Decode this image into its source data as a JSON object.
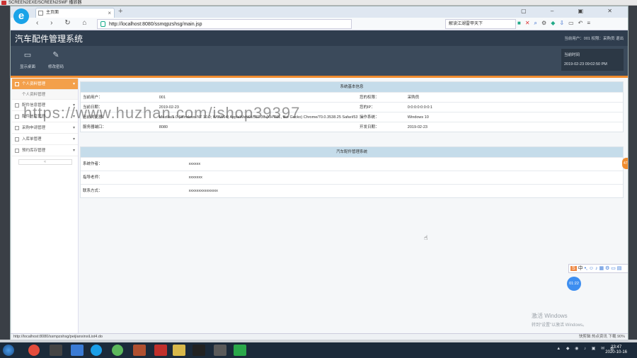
{
  "player": {
    "title": "SCREEN2EXE/SCREEN2SWF 播放器"
  },
  "browser": {
    "tab_title": "主页面",
    "url": "http://localhost:8080/ssmqpzshsg/main.jsp",
    "search_text": "解读江湖雷甲天下",
    "status_url": "http://localhost:8080/ssmpzshsg/peijianxinxiList4.do",
    "status_right": "快剪辑   热点资讯   下载   90%"
  },
  "app": {
    "title": "汽车配件管理系统",
    "userinfo": "当前用户：001  权限：采购员  退出",
    "toolbar": [
      {
        "label": "显示桌面",
        "icon": "monitor-icon"
      },
      {
        "label": "修改密码",
        "icon": "pencil-icon"
      }
    ],
    "time_label": "当前时间",
    "time_value": "2019-02-23 09:02:50 PM"
  },
  "sidebar": {
    "items": [
      {
        "label": "个人资料管理",
        "active": true
      },
      {
        "label": "个人资料管理",
        "sub": true
      },
      {
        "label": "配件信息管理"
      },
      {
        "label": "配件信息管理"
      },
      {
        "label": "采购申请管理"
      },
      {
        "label": "入库单管理"
      },
      {
        "label": "预约库存管理"
      }
    ],
    "collapse": "«"
  },
  "system_info": {
    "title": "系统基本信息",
    "rows": [
      {
        "k1": "当前用户：",
        "v1": "001",
        "k2": "您的权限：",
        "v2": "采购员"
      },
      {
        "k1": "当前日期：",
        "v1": "2019-02-23",
        "k2": "您的IP：",
        "v2": "0:0:0:0:0:0:0:1"
      },
      {
        "k1": "当前浏览器：",
        "v1": "Mozilla/5.0 (Windows NT 10.0; WOW64) AppleWebKit/537.36 (KHTML, like Gecko) Chrome/70.0.3538.25 Safari/537.36",
        "k2": "操作系统：",
        "v2": "Windows 10"
      },
      {
        "k1": "服务器端口：",
        "v1": "8080",
        "k2": "开发日期：",
        "v2": "2019-02-23"
      }
    ]
  },
  "app_info": {
    "title": "汽车配件管理系统",
    "rows": [
      {
        "k": "系统作者：",
        "v": "xxxxxx"
      },
      {
        "k": "指导老师：",
        "v": "xxxxxxx"
      },
      {
        "k": "联系方式：",
        "v": "xxxxxxxxxxxxxxx"
      }
    ]
  },
  "overlay": {
    "watermark_url": "https://www.huzhan.com/ishop39397",
    "activate_title": "激活 Windows",
    "activate_sub": "转到“设置”以激活 Windows。",
    "timer": "01:22",
    "side_tab": "47"
  },
  "taskbar": {
    "time": "23:47",
    "date": "2020-10-16"
  }
}
